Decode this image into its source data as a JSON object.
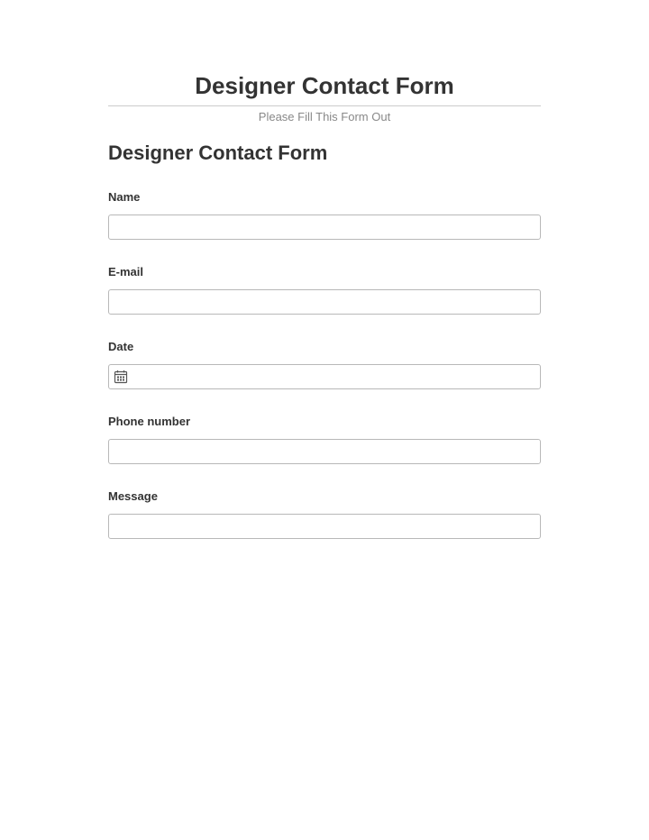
{
  "header": {
    "title": "Designer Contact Form",
    "subtitle": "Please Fill This Form Out"
  },
  "form": {
    "title": "Designer Contact Form",
    "fields": {
      "name": {
        "label": "Name",
        "value": ""
      },
      "email": {
        "label": "E-mail",
        "value": ""
      },
      "date": {
        "label": "Date",
        "value": ""
      },
      "phone": {
        "label": "Phone number",
        "value": ""
      },
      "message": {
        "label": "Message",
        "value": ""
      }
    }
  }
}
